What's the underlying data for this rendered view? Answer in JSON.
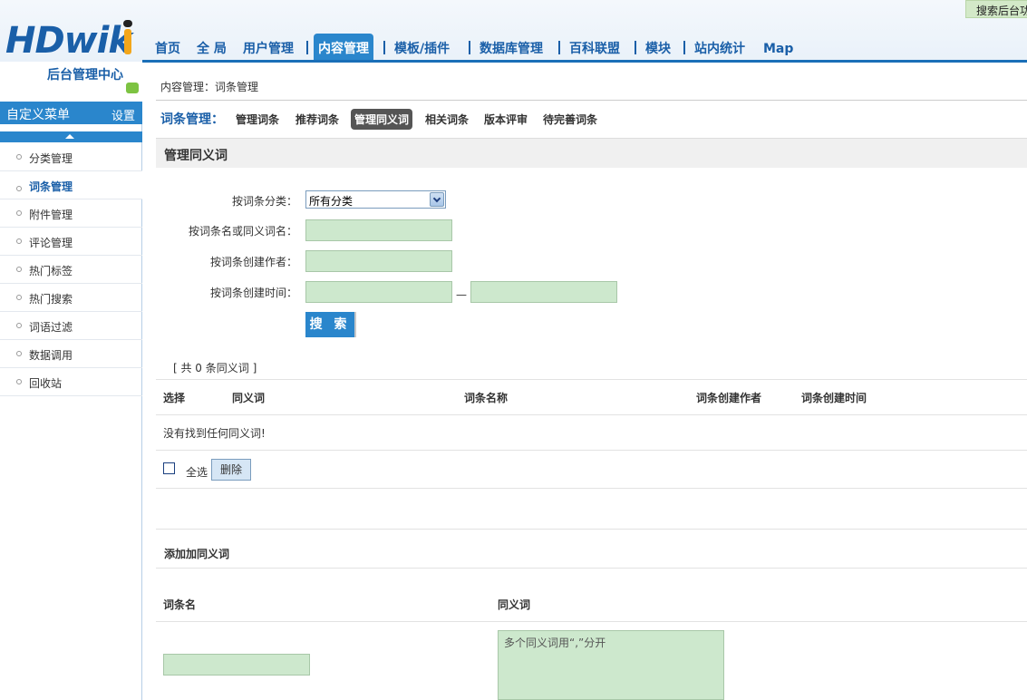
{
  "header": {
    "logo_text": "HDwik",
    "logo_subtitle": "后台管理中心",
    "search_back": "搜索后台功能",
    "nav": [
      "首页",
      "全 局",
      "用户管理",
      "内容管理",
      "模板/插件",
      "数据库管理",
      "百科联盟",
      "模块",
      "站内统计",
      "Map"
    ],
    "active_nav": "内容管理"
  },
  "sidebar": {
    "title": "自定义菜单",
    "settings": "设置",
    "items": [
      {
        "label": "分类管理"
      },
      {
        "label": "词条管理"
      },
      {
        "label": "附件管理"
      },
      {
        "label": "评论管理"
      },
      {
        "label": "热门标签"
      },
      {
        "label": "热门搜索"
      },
      {
        "label": "词语过滤"
      },
      {
        "label": "数据调用"
      },
      {
        "label": "回收站"
      }
    ],
    "active": "词条管理"
  },
  "breadcrumb": "内容管理：词条管理",
  "subnav": {
    "title": "词条管理：",
    "items": [
      "管理词条",
      "推荐词条",
      "管理同义词",
      "相关词条",
      "版本评审",
      "待完善词条"
    ],
    "active": "管理同义词"
  },
  "section_title": "管理同义词",
  "search_form": {
    "category_label": "按词条分类：",
    "category_value": "所有分类",
    "name_label": "按词条名或同义词名：",
    "author_label": "按词条创建作者：",
    "time_label": "按词条创建时间：",
    "date_separator": "—",
    "search_button": "搜 索"
  },
  "results": {
    "count_text": "[ 共 0 条同义词 ]",
    "columns": [
      "选择",
      "同义词",
      "词条名称",
      "词条创建作者",
      "词条创建时间"
    ],
    "empty_message": "没有找到任何同义词!",
    "select_all": "全选",
    "delete_button": "删除"
  },
  "add_section": {
    "title": "添加加同义词",
    "entry_label": "词条名",
    "synonym_label": "同义词",
    "synonym_placeholder": "多个同义词用“,”分开"
  }
}
